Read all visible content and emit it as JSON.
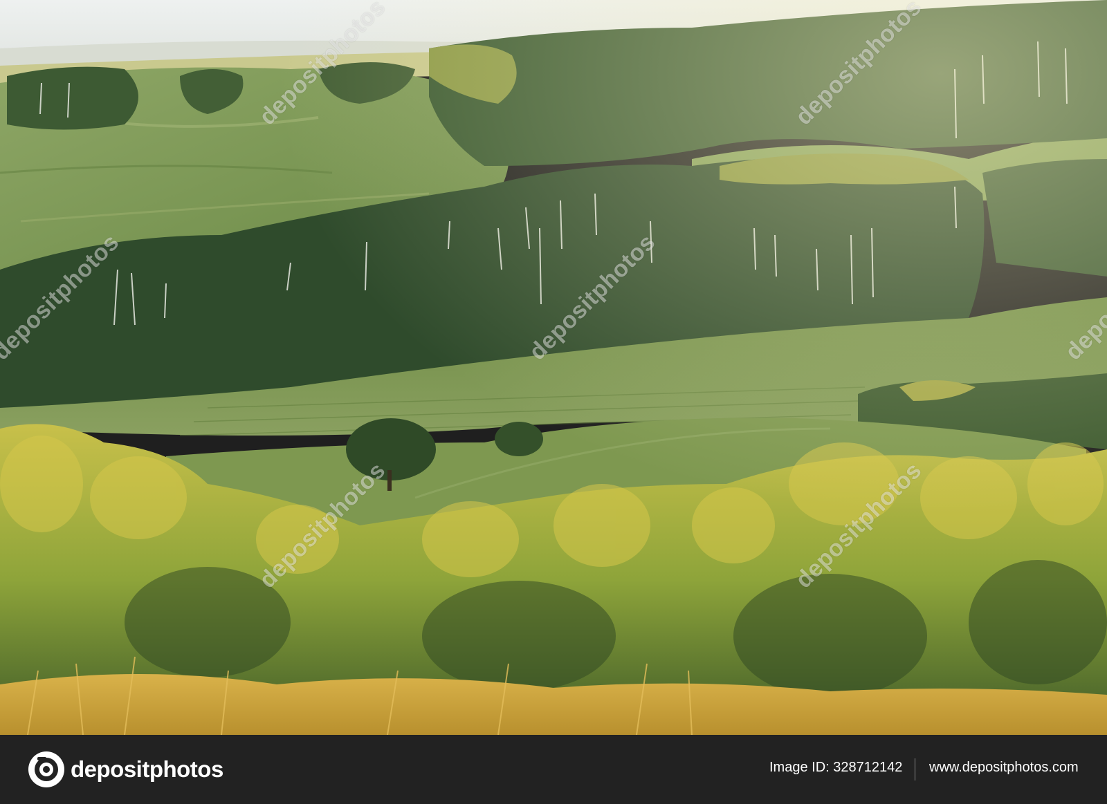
{
  "photo": {
    "description_icon": "landscape-photo",
    "watermark_text": "depositphotos"
  },
  "footer": {
    "logo_text": "depositphotos",
    "logo_icon": "camera-aperture-icon",
    "image_id_text": "Image ID: 328712142",
    "url_text": "www.depositphotos.com"
  },
  "colors": {
    "footer_bg": "#222222",
    "sky": "#e8ece9",
    "hill_green": "#7f9a55",
    "forest_dark": "#2f4a2c",
    "foliage_gold": "#c9b43a"
  }
}
